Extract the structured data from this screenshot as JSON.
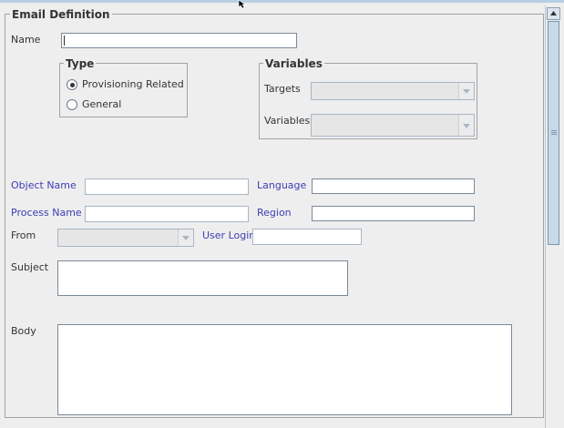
{
  "email_definition": {
    "title": "Email Definition",
    "name_label": "Name",
    "name_value": "",
    "type_group": {
      "title": "Type",
      "options": [
        {
          "label": "Provisioning Related",
          "checked": true
        },
        {
          "label": "General",
          "checked": false
        }
      ]
    },
    "variables_group": {
      "title": "Variables",
      "targets_label": "Targets",
      "targets_value": "",
      "variables_label": "Variables",
      "variables_value": ""
    },
    "object_name_label": "Object Name",
    "object_name_value": "",
    "language_label": "Language",
    "language_value": "",
    "process_name_label": "Process Name",
    "process_name_value": "",
    "region_label": "Region",
    "region_value": "",
    "from_label": "From",
    "from_value": "",
    "user_login_label": "User Login",
    "user_login_value": "",
    "subject_label": "Subject",
    "subject_value": "",
    "body_label": "Body",
    "body_value": ""
  },
  "colors": {
    "background": "#eeeeee",
    "highlight_label": "#3d3db5",
    "scroll_accent": "#c8daea"
  }
}
